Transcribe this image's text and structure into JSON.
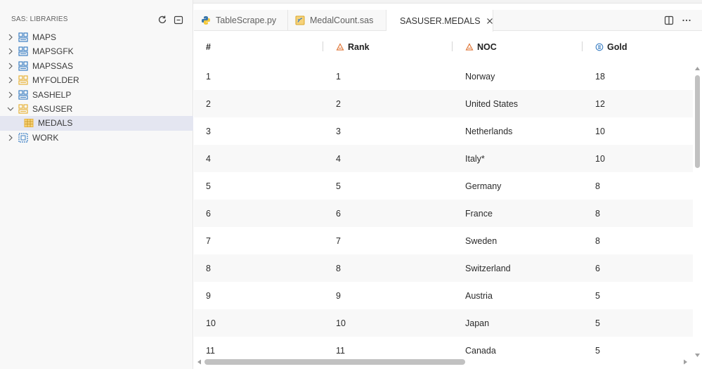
{
  "sidebar": {
    "title": "SAS: LIBRARIES",
    "items": [
      {
        "label": "MAPS",
        "expanded": false,
        "icon": "library-icon"
      },
      {
        "label": "MAPSGFK",
        "expanded": false,
        "icon": "library-icon"
      },
      {
        "label": "MAPSSAS",
        "expanded": false,
        "icon": "library-icon"
      },
      {
        "label": "MYFOLDER",
        "expanded": false,
        "icon": "folder-library-icon"
      },
      {
        "label": "SASHELP",
        "expanded": false,
        "icon": "library-icon"
      },
      {
        "label": "SASUSER",
        "expanded": true,
        "icon": "folder-library-icon"
      },
      {
        "label": "MEDALS",
        "child": true,
        "selected": true,
        "icon": "table-icon"
      },
      {
        "label": "WORK",
        "expanded": false,
        "icon": "work-library-icon"
      }
    ]
  },
  "tabs": [
    {
      "label": "TableScrape.py",
      "icon": "python-icon",
      "active": false
    },
    {
      "label": "MedalCount.sas",
      "icon": "sas-file-icon",
      "active": false
    },
    {
      "label": "SASUSER.MEDALS",
      "icon": "file-icon",
      "active": true
    }
  ],
  "grid": {
    "columns": [
      {
        "label": "#",
        "type": ""
      },
      {
        "label": "Rank",
        "type": "char-icon"
      },
      {
        "label": "NOC",
        "type": "char-icon"
      },
      {
        "label": "Gold",
        "type": "numeric-icon"
      }
    ],
    "rows": [
      [
        "1",
        "1",
        "Norway",
        "18"
      ],
      [
        "2",
        "2",
        "United States",
        "12"
      ],
      [
        "3",
        "3",
        "Netherlands",
        "10"
      ],
      [
        "4",
        "4",
        "Italy*",
        "10"
      ],
      [
        "5",
        "5",
        "Germany",
        "8"
      ],
      [
        "6",
        "6",
        "France",
        "8"
      ],
      [
        "7",
        "7",
        "Sweden",
        "8"
      ],
      [
        "8",
        "8",
        "Switzerland",
        "6"
      ],
      [
        "9",
        "9",
        "Austria",
        "5"
      ],
      [
        "10",
        "10",
        "Japan",
        "5"
      ],
      [
        "11",
        "11",
        "Canada",
        "5"
      ]
    ]
  },
  "colors": {
    "library": "#3c7fc4",
    "folder": "#e8b339",
    "char_type": "#e0783a",
    "numeric_type": "#3c7fc4",
    "selected_bg": "#e4e6f1"
  }
}
